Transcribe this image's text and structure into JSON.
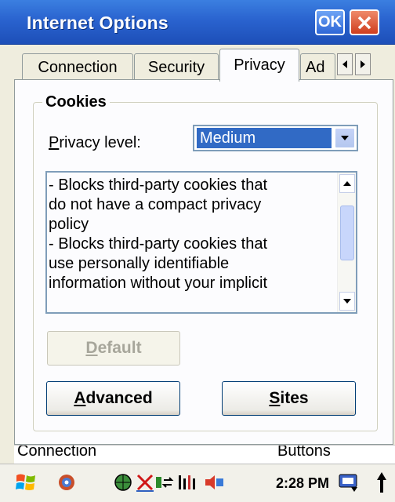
{
  "window": {
    "title": "Internet Options",
    "ok_label": "OK"
  },
  "tabs": [
    {
      "label": "Connection",
      "active": false
    },
    {
      "label": "Security",
      "active": false
    },
    {
      "label": "Privacy",
      "active": true
    },
    {
      "label": "Ad",
      "active": false
    }
  ],
  "cookies": {
    "group_label": "Cookies",
    "privacy_level_label": "Privacy level:",
    "privacy_level_value": "Medium",
    "description_lines": [
      "- Blocks third-party cookies that",
      "do not have a compact privacy",
      "policy",
      "- Blocks third-party cookies that",
      "use personally identifiable",
      "information without your implicit"
    ]
  },
  "buttons": {
    "default_label": "Default",
    "advanced_label": "Advanced",
    "sites_label": "Sites"
  },
  "background_row": {
    "left_text": "Connection",
    "right_text": "Buttons"
  },
  "taskbar": {
    "time": "2:28 PM"
  },
  "colors": {
    "title_bar": "#2a63cf",
    "selection": "#316ac5",
    "close": "#cf3d1e"
  }
}
